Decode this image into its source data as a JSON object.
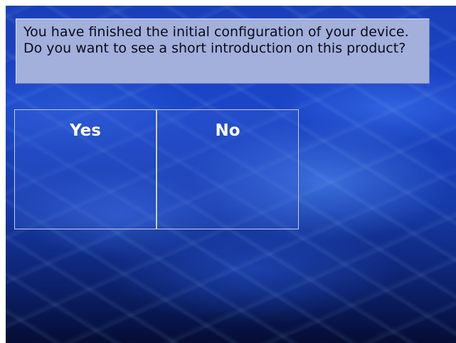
{
  "dialog": {
    "message": "You have finished the initial configuration of your device. Do you want to see a short introduction on this product?"
  },
  "buttons": {
    "yes_label": "Yes",
    "no_label": "No"
  },
  "colors": {
    "message_panel": "#a3b0dc",
    "button_border": "#c8d4f2",
    "background_top": "#1a3fb8",
    "background_bottom": "#050d33"
  }
}
